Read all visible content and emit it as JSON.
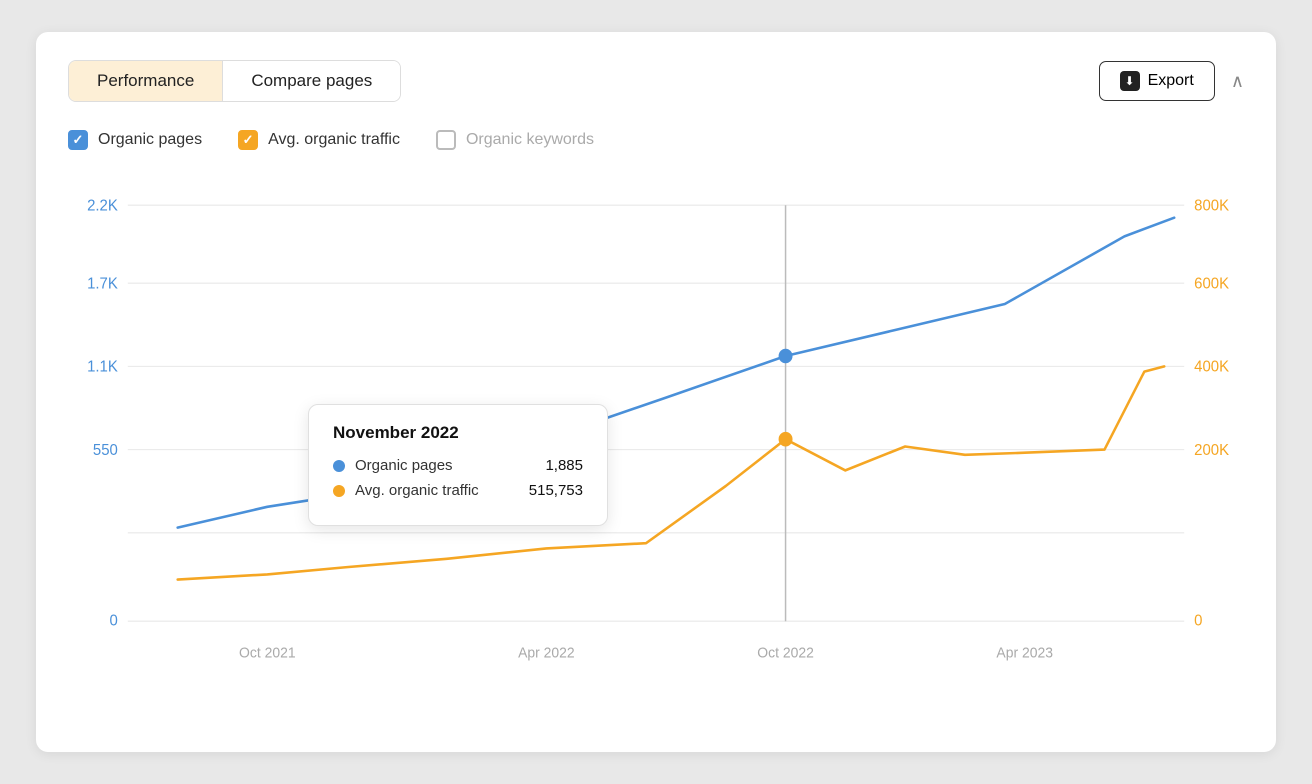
{
  "tabs": [
    {
      "id": "performance",
      "label": "Performance",
      "active": true
    },
    {
      "id": "compare",
      "label": "Compare pages",
      "active": false
    }
  ],
  "export_button": {
    "label": "Export"
  },
  "checkboxes": [
    {
      "id": "organic-pages",
      "label": "Organic pages",
      "state": "blue"
    },
    {
      "id": "avg-traffic",
      "label": "Avg. organic traffic",
      "state": "orange"
    },
    {
      "id": "keywords",
      "label": "Organic keywords",
      "state": "unchecked"
    }
  ],
  "chart": {
    "y_left_labels": [
      "2.2K",
      "1.7K",
      "1.1K",
      "550",
      "0"
    ],
    "y_right_labels": [
      "800K",
      "600K",
      "400K",
      "200K",
      "0"
    ],
    "x_labels": [
      "Oct 2021",
      "Apr 2022",
      "Oct 2022",
      "Apr 2023"
    ],
    "tooltip": {
      "title": "November 2022",
      "rows": [
        {
          "color": "#4a90d9",
          "label": "Organic pages",
          "value": "1,885"
        },
        {
          "color": "#f5a623",
          "label": "Avg. organic traffic",
          "value": "515,753"
        }
      ]
    }
  }
}
